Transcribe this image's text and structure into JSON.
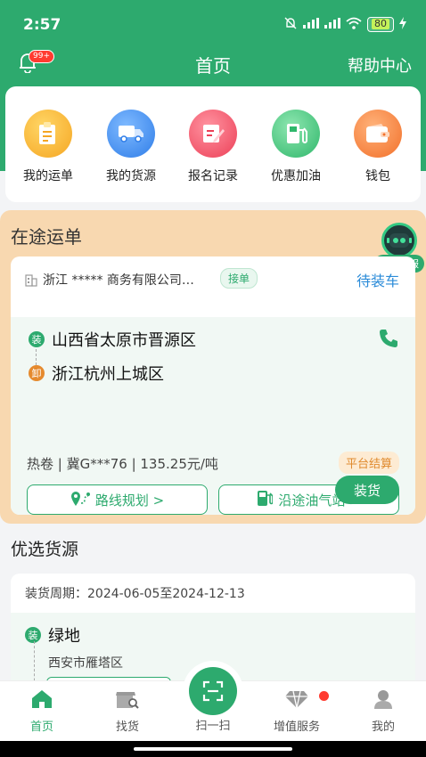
{
  "status_bar": {
    "time": "2:57",
    "battery": "80"
  },
  "header": {
    "badge": "99+",
    "title": "首页",
    "help": "帮助中心"
  },
  "quick_actions": [
    {
      "label": "我的运单",
      "color": "#f5b731"
    },
    {
      "label": "我的货源",
      "color": "#3b8ff0"
    },
    {
      "label": "报名记录",
      "color": "#f2556a"
    },
    {
      "label": "优惠加油",
      "color": "#3ec47c"
    },
    {
      "label": "钱包",
      "color": "#f58a3a"
    }
  ],
  "in_transit": {
    "title": "在途运单",
    "kefu_label": "在线客服",
    "company": "浙江 ***** 商务有限公司…",
    "jiedan": "接单",
    "status": "待装车",
    "load_marker": "装",
    "load_place": "山西省太原市晋源区",
    "unload_marker": "卸",
    "unload_place": "浙江杭州上城区",
    "cargo_info": "热卷 | 冀G***76 | 135.25元/吨",
    "settlement": "平台结算",
    "route_btn": "路线规划 >",
    "gas_btn": "沿途油气站 >",
    "load_btn": "装货"
  },
  "preferred": {
    "title": "优选货源",
    "period": "装货周期：2024-06-05至2024-12-13",
    "marker": "装",
    "dest": "绿地",
    "sub": "西安市雁塔区"
  },
  "tabbar": {
    "home": "首页",
    "find": "找货",
    "scan": "扫一扫",
    "value": "增值服务",
    "mine": "我的"
  },
  "colors": {
    "primary": "#2daa6e",
    "transit_bg": "#f8d8b0",
    "status_blue": "#2b8bd8"
  }
}
